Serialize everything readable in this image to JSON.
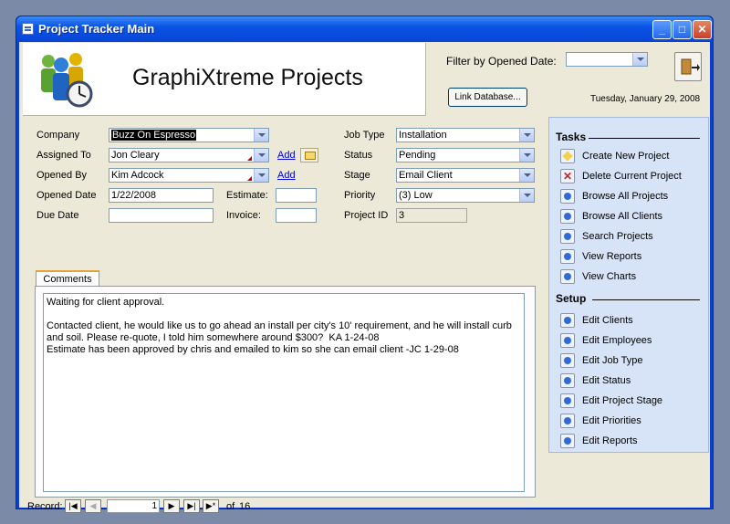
{
  "window": {
    "title": "Project Tracker Main",
    "minimize": "_",
    "maximize": "□",
    "close": "✕"
  },
  "header": {
    "app_title": "GraphiXtreme Projects",
    "filter_label": "Filter by Opened Date:",
    "filter_value": "",
    "link_db_label": "Link Database...",
    "date_text": "Tuesday, January 29, 2008"
  },
  "form": {
    "company_label": "Company",
    "company_value": "Buzz On Espresso",
    "assigned_label": "Assigned To",
    "assigned_value": "Jon Cleary",
    "opened_by_label": "Opened By",
    "opened_by_value": "Kim Adcock",
    "add_label": "Add",
    "opened_date_label": "Opened Date",
    "opened_date_value": "1/22/2008",
    "due_date_label": "Due Date",
    "due_date_value": "",
    "estimate_label": "Estimate:",
    "estimate_value": "",
    "invoice_label": "Invoice:",
    "invoice_value": "",
    "job_type_label": "Job Type",
    "job_type_value": "Installation",
    "status_label": "Status",
    "status_value": "Pending",
    "stage_label": "Stage",
    "stage_value": "Email Client",
    "priority_label": "Priority",
    "priority_value": "(3) Low",
    "project_id_label": "Project ID",
    "project_id_value": "3"
  },
  "comments": {
    "tab_label": "Comments",
    "text": "Waiting for client approval.\n\nContacted client, he would like us to go ahead an install per city's 10' requirement, and he will install curb and soil. Please re-quote, I told him somewhere around $300?  KA 1-24-08\nEstimate has been approved by chris and emailed to kim so she can email client -JC 1-29-08"
  },
  "record_nav": {
    "label": "Record:",
    "current": "1",
    "of_label": "of",
    "total": "16",
    "first": "|◀",
    "prev": "◀",
    "next": "▶",
    "last": "▶|",
    "new": "▶*"
  },
  "tasks": {
    "heading": "Tasks",
    "items": [
      "Create New Project",
      "Delete Current Project",
      "Browse All Projects",
      "Browse All Clients",
      "Search Projects",
      "View Reports",
      "View Charts"
    ]
  },
  "setup": {
    "heading": "Setup",
    "items": [
      "Edit Clients",
      "Edit Employees",
      "Edit Job Type",
      "Edit Status",
      "Edit Project Stage",
      "Edit Priorities",
      "Edit Reports"
    ]
  }
}
